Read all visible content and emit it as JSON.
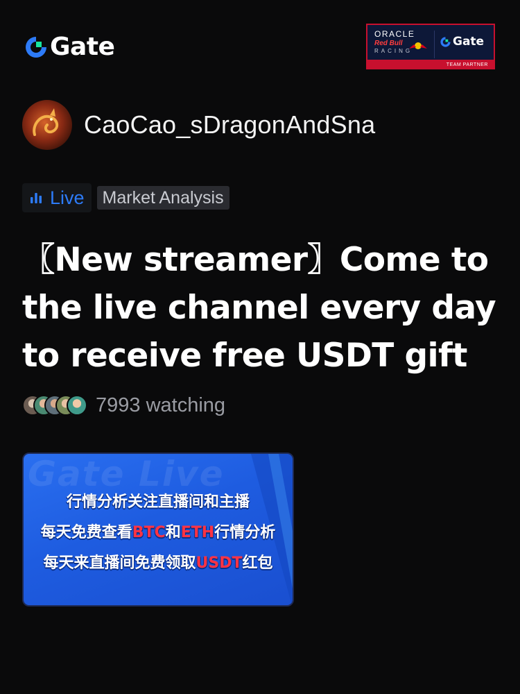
{
  "header": {
    "logo_text": "Gate",
    "partner": {
      "oracle": "ORACLE",
      "red_bull": "Red Bull",
      "racing": "RACING",
      "gate": "Gate",
      "band": "TEAM PARTNER"
    }
  },
  "author": {
    "name": "CaoCao_sDragonAndSna"
  },
  "tags": {
    "live": "Live",
    "category": "Market Analysis"
  },
  "post": {
    "title": "〖New streamer〗Come to the live channel every day to receive free USDT gift c..."
  },
  "audience": {
    "watching_text": "7993 watching"
  },
  "banner": {
    "watermark": "Gate Live",
    "line1": "行情分析关注直播间和主播",
    "line2_a": "每天免费查看",
    "line2_b": "BTC",
    "line2_c": "和",
    "line2_d": "ETH",
    "line2_e": "行情分析",
    "line3_a": "每天来直播间免费领取",
    "line3_b": "USDT",
    "line3_c": "红包"
  },
  "colors": {
    "background": "#0a0a0b",
    "gate_blue": "#2d7bf8",
    "gate_green": "#17e5a0",
    "live_text": "#2d7bf8",
    "partner_red": "#c8102e",
    "highlight_red": "#ff3344"
  },
  "icons": {
    "logo": "gate-logo-icon",
    "live": "bar-chart-icon",
    "bull": "red-bull-icon"
  }
}
